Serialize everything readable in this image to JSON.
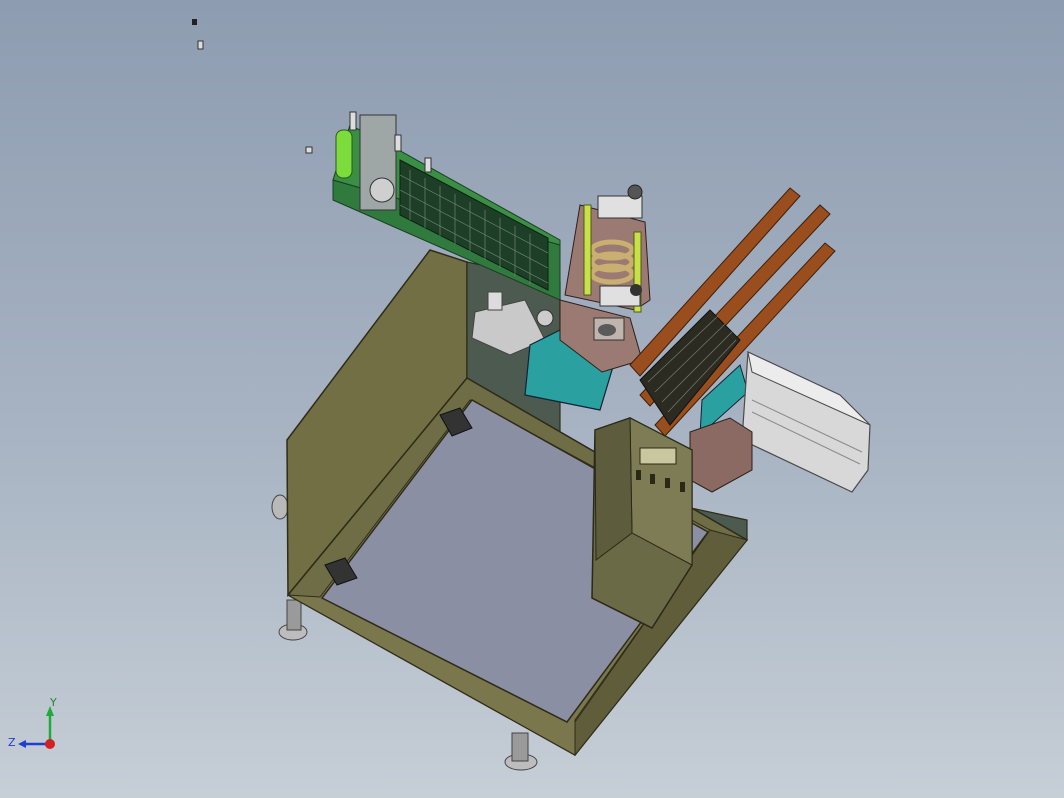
{
  "viewport": {
    "background_top": "#8e9cb1",
    "background_bottom": "#c6ced6"
  },
  "model": {
    "parts": {
      "frame": "#6f6d46",
      "panel": "#8b8fa3",
      "feed_tray": "#2f7a3c",
      "teal_box": "#2aa0a0",
      "copper_rails": "#9a4e1d",
      "motor": "#d8d8d8",
      "control_box": "#6b6a47",
      "hinges": "#333333"
    }
  },
  "triad": {
    "x_label": "",
    "y_label": "Y",
    "z_label": "Z",
    "x_color": "#d32020",
    "y_color": "#1faa3a",
    "z_color": "#1f3fd0"
  }
}
